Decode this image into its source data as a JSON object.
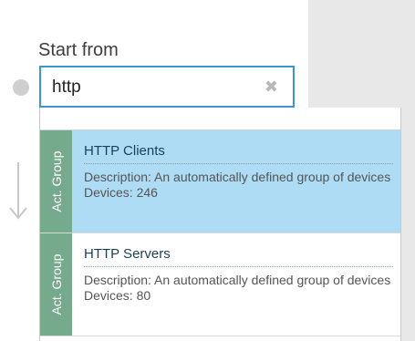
{
  "start": {
    "label": "Start from",
    "search_value": "http",
    "clear_icon": "close-icon"
  },
  "results": [
    {
      "type": "Act. Group",
      "name": "HTTP Clients",
      "description": "Description: An automatically defined group of devices",
      "devices": "Devices: 246",
      "selected": true
    },
    {
      "type": "Act. Group",
      "name": "HTTP Servers",
      "description": "Description: An automatically defined group of devices",
      "devices": "Devices: 80",
      "selected": false
    }
  ],
  "colors": {
    "accent": "#3a97d6",
    "selected_row": "#aedcf5",
    "type_tab": "#76aa8d"
  }
}
